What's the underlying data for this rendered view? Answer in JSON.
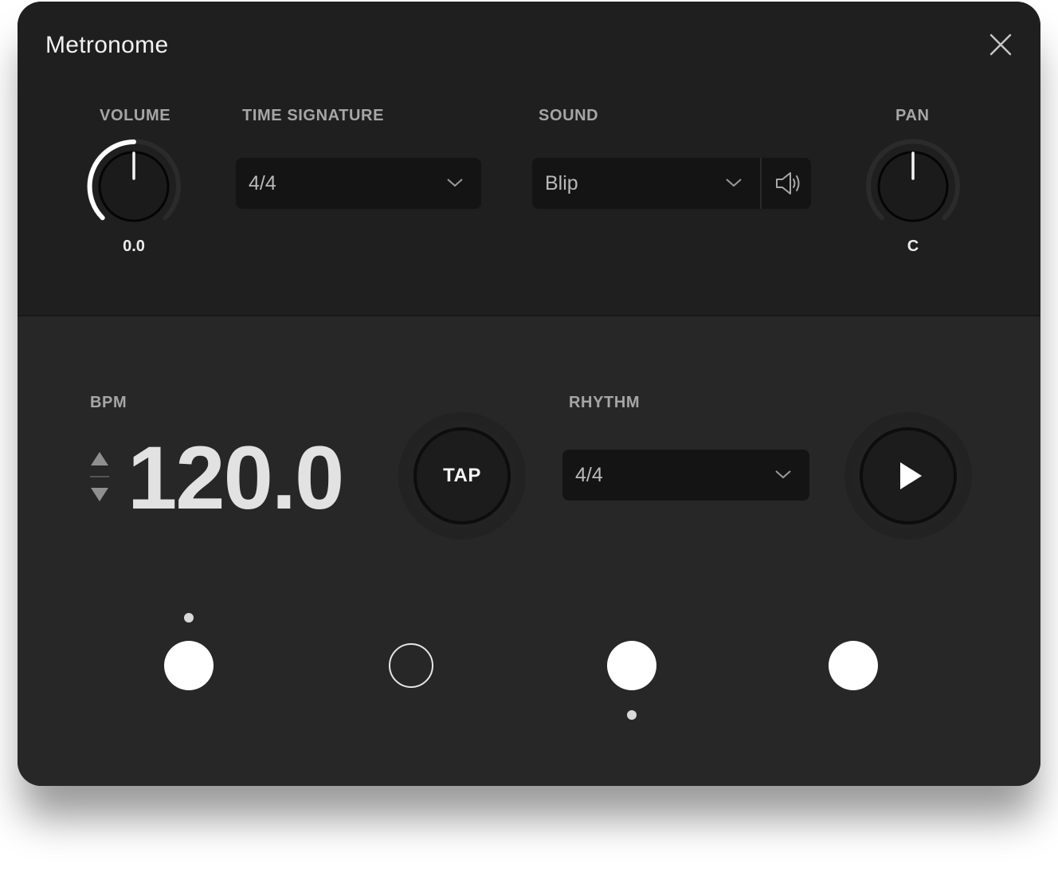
{
  "window": {
    "title": "Metronome"
  },
  "icons": {
    "close": "close-icon",
    "speaker": "speaker-icon",
    "play": "play-icon",
    "step_up": "triangle-up-icon",
    "step_down": "triangle-down-icon"
  },
  "colors": {
    "accent": "#ffffff",
    "panel_top": "#1f1f1f",
    "panel_bottom": "#272727",
    "field": "#141414"
  },
  "volume": {
    "label": "VOLUME",
    "value": "0.0",
    "level": 0.5
  },
  "time_signature": {
    "label": "TIME SIGNATURE",
    "selected": "4/4"
  },
  "sound": {
    "label": "SOUND",
    "selected": "Blip"
  },
  "pan": {
    "label": "PAN",
    "value": "C"
  },
  "bpm": {
    "label": "BPM",
    "value": "120.0"
  },
  "tap": {
    "label": "TAP"
  },
  "rhythm": {
    "label": "RHYTHM",
    "selected": "4/4"
  },
  "beats": [
    {
      "state": "filled",
      "accent": "above"
    },
    {
      "state": "empty",
      "accent": "none"
    },
    {
      "state": "filled",
      "accent": "below"
    },
    {
      "state": "filled",
      "accent": "none"
    }
  ]
}
